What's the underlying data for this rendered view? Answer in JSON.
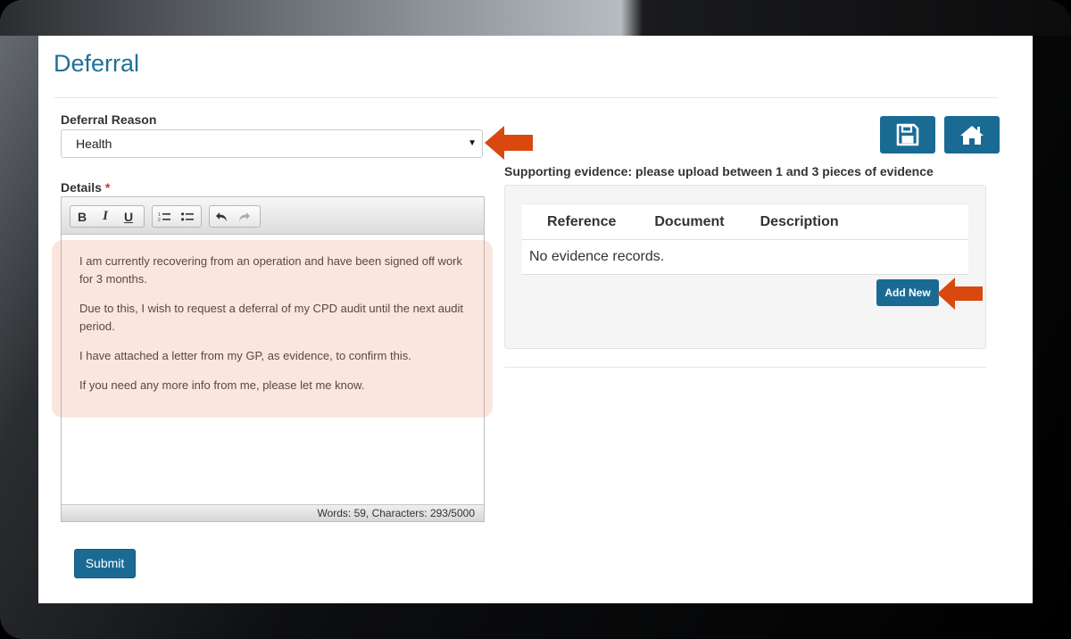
{
  "page": {
    "title": "Deferral"
  },
  "form": {
    "reason_label": "Deferral Reason",
    "reason_value": "Health",
    "details_label": "Details",
    "required_marker": "*",
    "details_paragraphs": [
      "I am currently recovering from an operation and have been signed off work for 3 months.",
      "Due to this, I wish to request a deferral of my CPD audit until the next audit period.",
      "I have attached a letter from my GP, as evidence, to confirm this.",
      "If you need any more info from me, please let me know."
    ],
    "editor_status": "Words: 59, Characters: 293/5000",
    "toolbar": {
      "bold_label": "B",
      "italic_label": "I",
      "underline_label": "U"
    },
    "submit_label": "Submit"
  },
  "actions": {
    "save_icon": "floppy-disk-icon",
    "home_icon": "home-icon"
  },
  "evidence": {
    "label": "Supporting evidence: please upload between 1 and 3 pieces of evidence",
    "columns": [
      "Reference",
      "Document",
      "Description"
    ],
    "empty_text": "No evidence records.",
    "add_new_label": "Add New"
  },
  "annotations": {
    "arrow_color": "#d9480f"
  },
  "colors": {
    "accent": "#1a6b94",
    "title": "#1f6f9a",
    "highlight": "#f4d9cf"
  }
}
